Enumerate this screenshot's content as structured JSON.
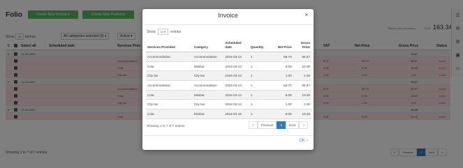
{
  "page": {
    "title": "Folio",
    "buttons": {
      "new_invoice": "Create New Invoice ▾",
      "new_proforma": "Create New Proforma"
    },
    "summary": {
      "label": "Filtered item summary",
      "currency": "EUR",
      "value": "163.34"
    },
    "show": {
      "prefix": "Show",
      "value": "10",
      "suffix": "entries"
    },
    "category_filter": "All categories selected (3) ▾",
    "status_filter": "Active ▾",
    "columns": {
      "select_all": "Select all",
      "scheduled_date": "Scheduled date",
      "services": "Services Prov",
      "vat": "VAT",
      "net_price": "Net Price",
      "gross_price": "Gross Price",
      "status": "Status"
    },
    "groups": [
      {
        "date": "13-03-2024",
        "gross": "76.67",
        "rows": [
          {
            "service": "Accommodation",
            "vat": "5.97",
            "net": "59.70",
            "gross": "65.67",
            "status": "Active"
          },
          {
            "service": "Cola",
            "vat": "0.91",
            "net": "9.09",
            "gross": "10.00",
            "status": "Active"
          },
          {
            "service": "City tax",
            "vat": "0.00",
            "net": "1.00",
            "gross": "1.00",
            "status": "Active"
          }
        ]
      },
      {
        "date": "14-03-2024",
        "gross": "76.67",
        "rows": [
          {
            "service": "Accommodation",
            "vat": "5.97",
            "net": "59.70",
            "gross": "65.67",
            "status": "Active"
          },
          {
            "service": "Cola",
            "vat": "0.91",
            "net": "9.09",
            "gross": "10.00",
            "status": "Active"
          },
          {
            "service": "City tax",
            "vat": "0.00",
            "net": "1.00",
            "gross": "1.00",
            "status": "Active"
          }
        ]
      },
      {
        "date": "15-03-2024",
        "gross": "10.00",
        "rows": [
          {
            "service": "Cola",
            "vat": "0.91",
            "net": "9.09",
            "gross": "10.00",
            "status": "Active"
          }
        ]
      }
    ],
    "footer_info": "Showing 1 to 7 of 7 entries",
    "pager": {
      "previous": "Previous",
      "current": "1",
      "next": "Next"
    }
  },
  "modal": {
    "title": "Invoice",
    "close": "×",
    "show": {
      "prefix": "Show",
      "value": "10 ▾",
      "suffix": "entries"
    },
    "headers": {
      "services": "Services Provided",
      "category": "Category",
      "scheduled": "Scheduled date",
      "quantity": "Quantity",
      "net": "Net Price",
      "gross": "Gross Price"
    },
    "rows": [
      {
        "service": "Accommodation",
        "category": "Accommodation",
        "date": "2024-03-13",
        "qty": "1",
        "net": "59.70",
        "gross": "65.67"
      },
      {
        "service": "Cola",
        "category": "Minibar",
        "date": "2024-03-13",
        "qty": "1",
        "net": "9.09",
        "gross": "10.00"
      },
      {
        "service": "City tax",
        "category": "City tax",
        "date": "2024-03-13",
        "qty": "1",
        "net": "1.00",
        "gross": "1.00"
      },
      {
        "service": "Accommodation",
        "category": "Accommodation",
        "date": "2024-03-14",
        "qty": "1",
        "net": "59.70",
        "gross": "65.67"
      },
      {
        "service": "Cola",
        "category": "Minibar",
        "date": "2024-03-14",
        "qty": "1",
        "net": "9.09",
        "gross": "10.00"
      },
      {
        "service": "City tax",
        "category": "City tax",
        "date": "2024-03-14",
        "qty": "1",
        "net": "1.00",
        "gross": "1.00"
      },
      {
        "service": "Cola",
        "category": "Minibar",
        "date": "2024-03-15",
        "qty": "1",
        "net": "9.09",
        "gross": "10.00"
      }
    ],
    "info": "Showing 1 to 7 of 7 entries",
    "pager": {
      "first": "«",
      "previous": "Previous",
      "current": "1",
      "next": "Next",
      "last": "»"
    },
    "ok_label": "OK"
  },
  "colors": {
    "accent": "#337ab7",
    "green": "#5cb85c",
    "pink_row": "#f6dcdc",
    "status_red": "#d9534f"
  },
  "icons": [
    "list-icon",
    "mail-icon",
    "gear-icon",
    "wallet-icon",
    "monitor-icon",
    "close-icon",
    "chevron-right-icon"
  ]
}
